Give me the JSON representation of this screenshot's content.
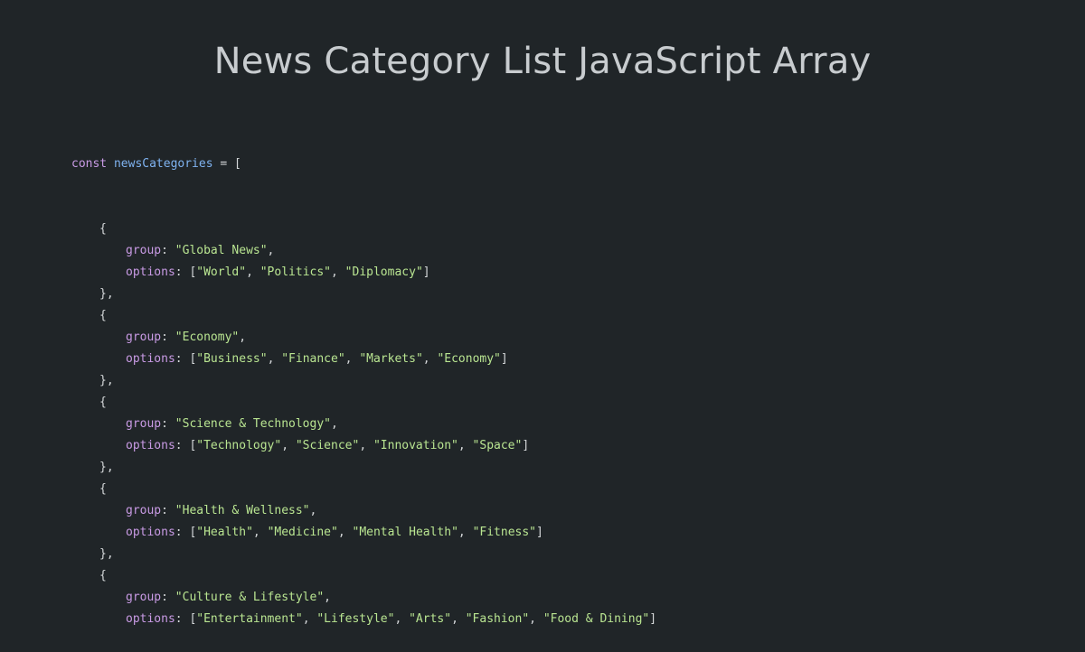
{
  "title": "News Category List JavaScript Array",
  "code": {
    "keyword": "const",
    "variable": "newsCategories",
    "assign": " = [",
    "open_brace": "{",
    "close_brace": "},",
    "group_key": "group",
    "options_key": "options",
    "groups": [
      {
        "group": "\"Global News\"",
        "options": [
          "\"World\"",
          "\"Politics\"",
          "\"Diplomacy\""
        ]
      },
      {
        "group": "\"Economy\"",
        "options": [
          "\"Business\"",
          "\"Finance\"",
          "\"Markets\"",
          "\"Economy\""
        ]
      },
      {
        "group": "\"Science & Technology\"",
        "options": [
          "\"Technology\"",
          "\"Science\"",
          "\"Innovation\"",
          "\"Space\""
        ]
      },
      {
        "group": "\"Health & Wellness\"",
        "options": [
          "\"Health\"",
          "\"Medicine\"",
          "\"Mental Health\"",
          "\"Fitness\""
        ]
      },
      {
        "group": "\"Culture & Lifestyle\"",
        "options": [
          "\"Entertainment\"",
          "\"Lifestyle\"",
          "\"Arts\"",
          "\"Fashion\"",
          "\"Food & Dining\""
        ]
      }
    ]
  },
  "colors": {
    "background": "#202528",
    "title": "#c8cccf",
    "keyword": "#c99be5",
    "variable": "#7fb3f0",
    "string": "#b9e591",
    "punctuation": "#d5d8da"
  }
}
